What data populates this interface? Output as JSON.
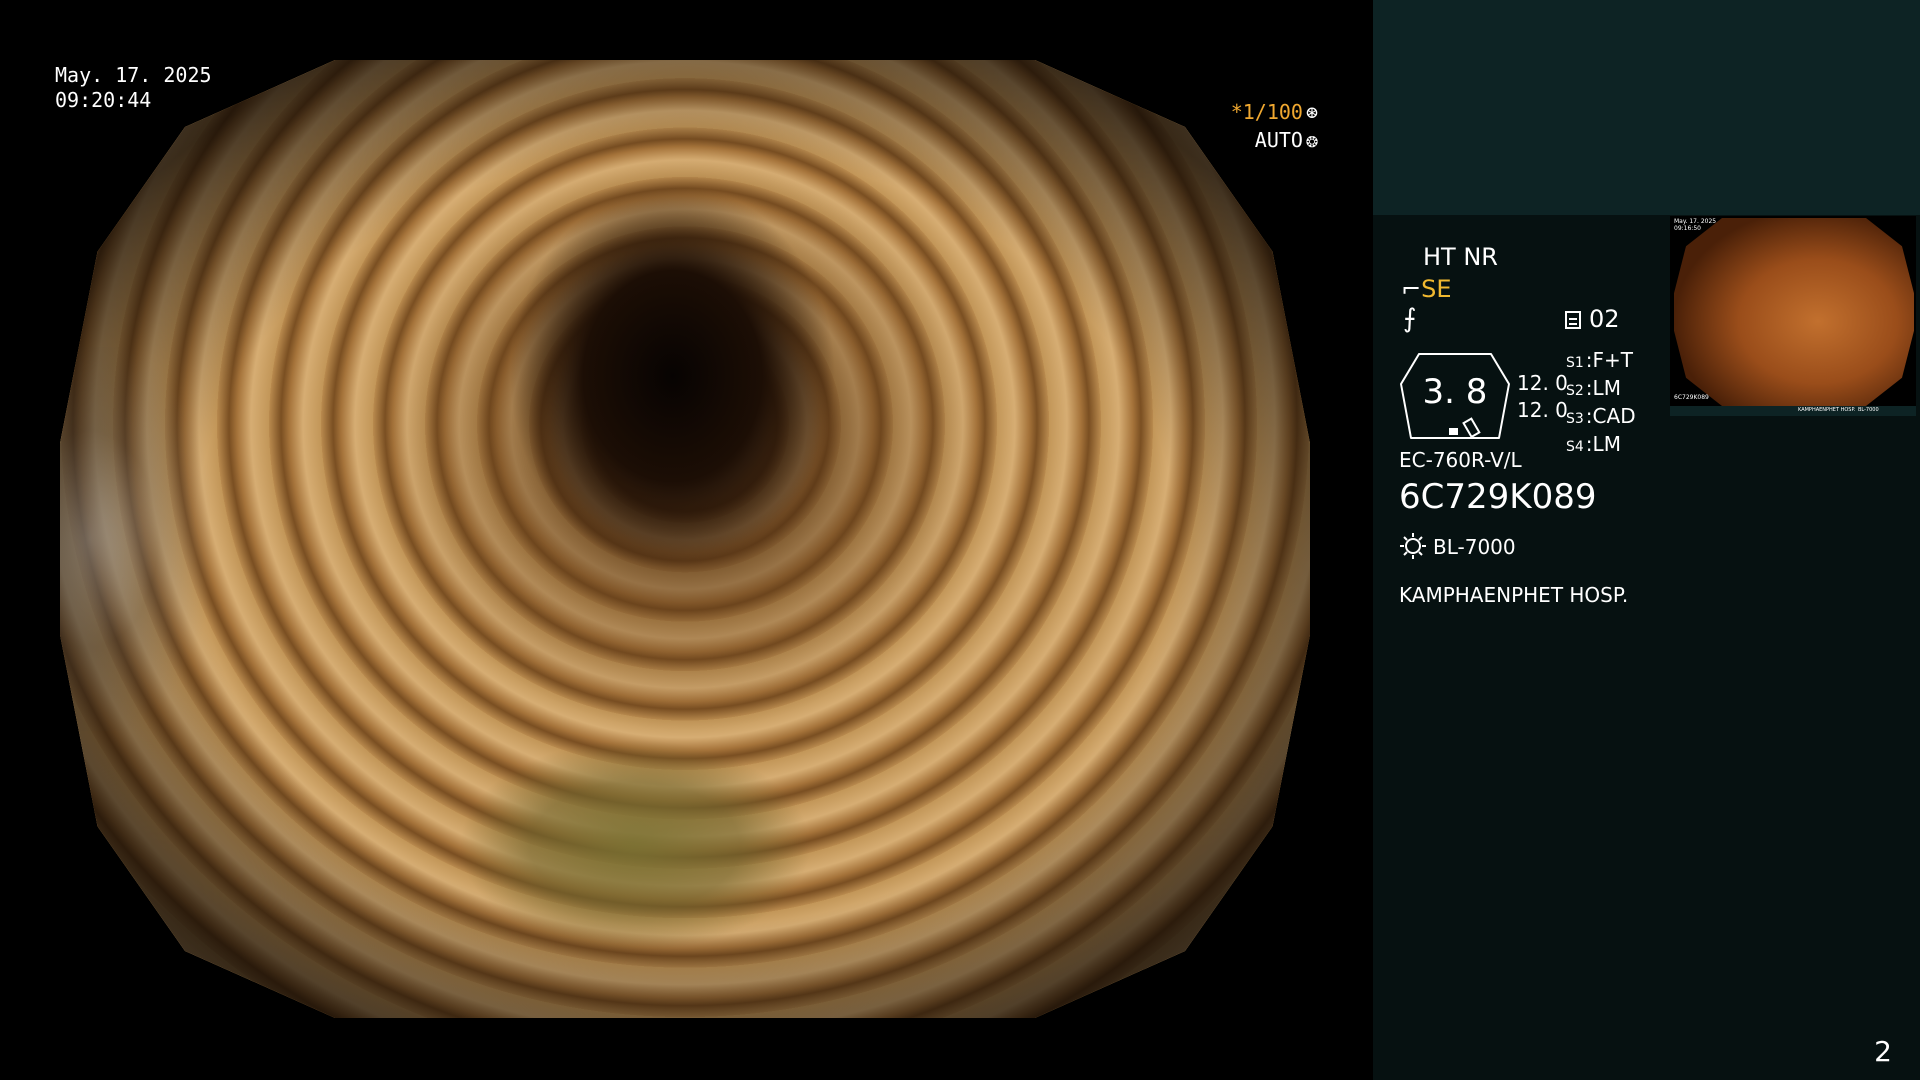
{
  "overlay": {
    "date": "May. 17. 2025",
    "time": "09:20:44",
    "shutter": "*1/100",
    "iris": "AUTO"
  },
  "panel": {
    "modes": "HT NR",
    "se_label": "SE",
    "preset": "02",
    "gauge_value": "3. 8",
    "value_1": "12. 0",
    "value_2": "12. 0",
    "scope_settings": [
      {
        "key": "S1",
        "value": "F+T"
      },
      {
        "key": "S2",
        "value": "LM"
      },
      {
        "key": "S3",
        "value": "CAD"
      },
      {
        "key": "S4",
        "value": "LM"
      }
    ],
    "model": "EC-760R-V/L",
    "serial": "6C729K089",
    "light_source": "BL-7000",
    "hospital": "KAMPHAENPHET HOSP.",
    "page_number": "2"
  },
  "thumbnail": {
    "date": "May. 17. 2025",
    "time": "09:16:50",
    "serial": "6C729K089",
    "hospital": "KAMPHAENPHET HOSP.",
    "light": "BL-7000"
  },
  "colors": {
    "panel_bg": "#061111",
    "panel_top_bg": "#0d2324",
    "accent_orange": "#f0a830",
    "accent_yellow": "#f0b830"
  }
}
